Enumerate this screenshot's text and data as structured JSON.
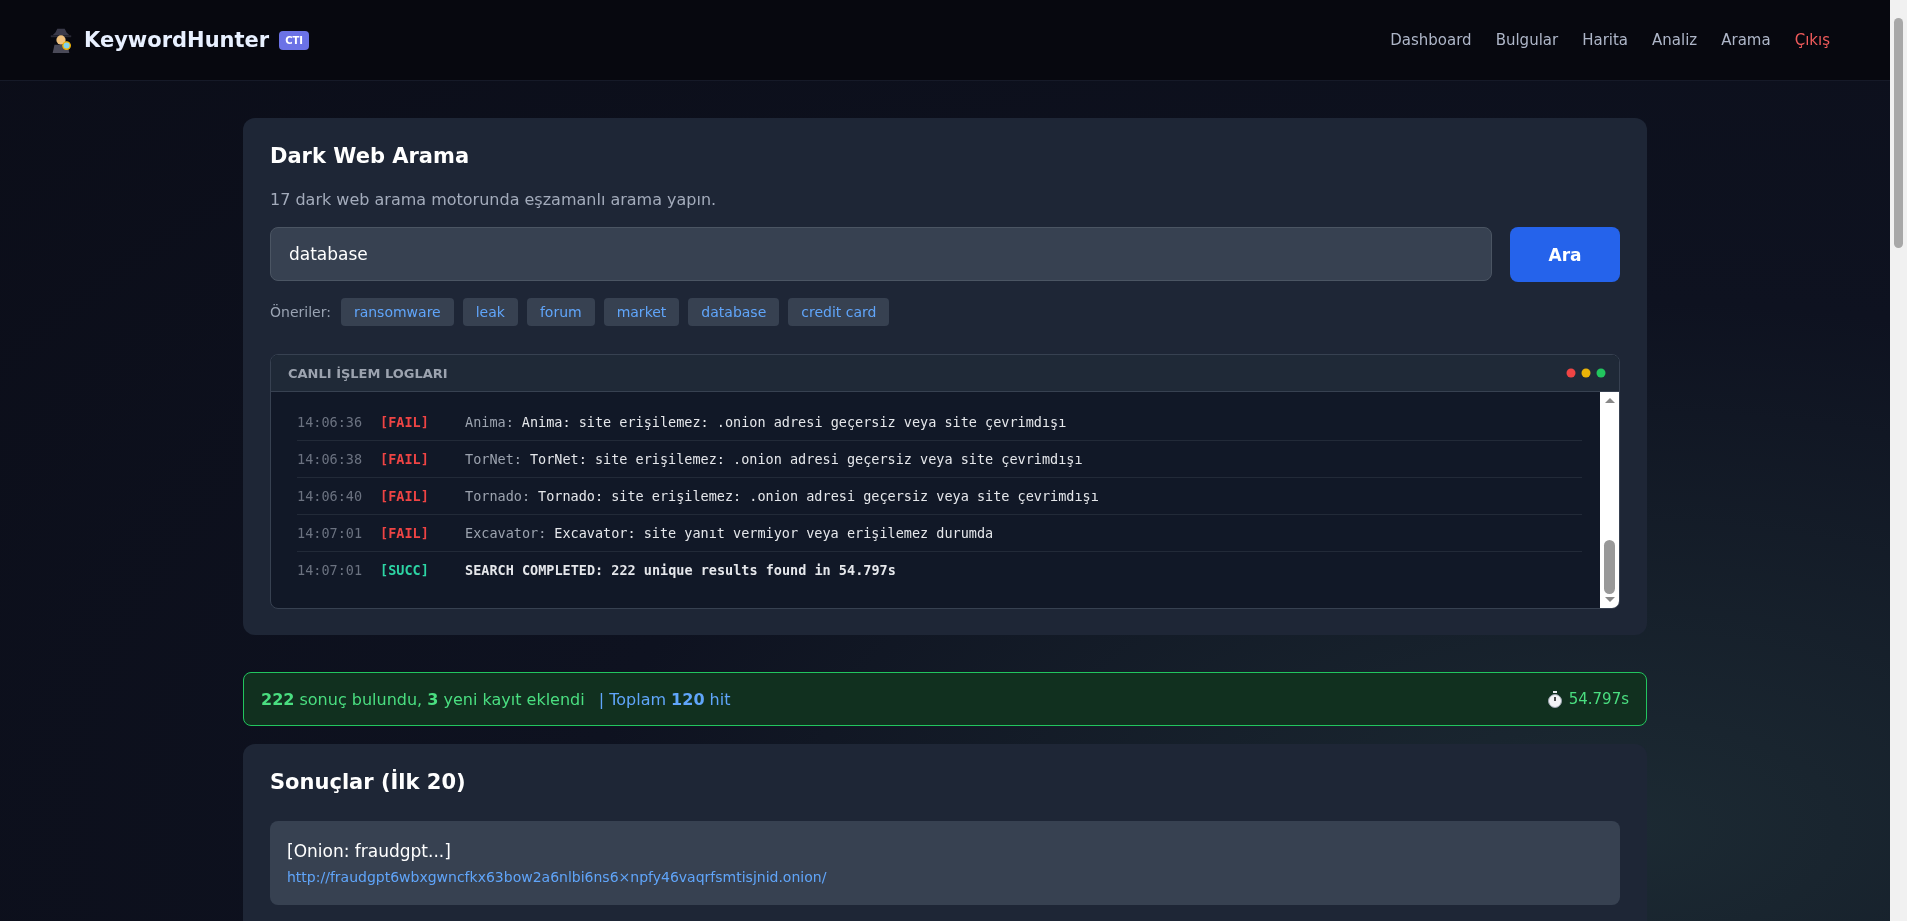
{
  "brand": {
    "name": "KeywordHunter",
    "badge": "CTI"
  },
  "nav": [
    {
      "label": "Dashboard",
      "kind": "link"
    },
    {
      "label": "Bulgular",
      "kind": "link"
    },
    {
      "label": "Harita",
      "kind": "link"
    },
    {
      "label": "Analiz",
      "kind": "link"
    },
    {
      "label": "Arama",
      "kind": "link"
    },
    {
      "label": "Çıkış",
      "kind": "logout"
    }
  ],
  "search_card": {
    "title": "Dark Web Arama",
    "subtitle": "17 dark web arama motorunda eşzamanlı arama yapın.",
    "query": "database",
    "button": "Ara",
    "suggestions_label": "Öneriler:",
    "suggestions": [
      "ransomware",
      "leak",
      "forum",
      "market",
      "database",
      "credit card"
    ]
  },
  "log": {
    "title": "CANLI İŞLEM LOGLARI",
    "rows": [
      {
        "time": "14:06:36",
        "level": "[FAIL]",
        "kind": "fail",
        "source": "Anima:",
        "message": "Anima: site erişilemez: .onion adresi geçersiz veya site çevrimdışı"
      },
      {
        "time": "14:06:38",
        "level": "[FAIL]",
        "kind": "fail",
        "source": "TorNet:",
        "message": "TorNet: site erişilemez: .onion adresi geçersiz veya site çevrimdışı"
      },
      {
        "time": "14:06:40",
        "level": "[FAIL]",
        "kind": "fail",
        "source": "Tornado:",
        "message": "Tornado: site erişilemez: .onion adresi geçersiz veya site çevrimdışı"
      },
      {
        "time": "14:07:01",
        "level": "[FAIL]",
        "kind": "fail",
        "source": "Excavator:",
        "message": "Excavator: site yanıt vermiyor veya erişilemez durumda"
      },
      {
        "time": "14:07:01",
        "level": "[SUCC]",
        "kind": "succ",
        "message": "SEARCH COMPLETED: 222 unique results found in 54.797s"
      }
    ]
  },
  "summary": {
    "found": "**222** sonuç bulundu, **3** yeni kayıt eklendi",
    "total": "| Toplam **120** hit",
    "elapsed": "54.797s"
  },
  "results": {
    "title": "Sonuçlar (İlk 20)",
    "items": [
      {
        "title": "[Onion: fraudgpt...]",
        "url": "http://fraudgpt6wbxgwncfkx63bow2a6nlbi6ns6×npfy46vaqrfsmtisjnid.onion/"
      }
    ]
  }
}
